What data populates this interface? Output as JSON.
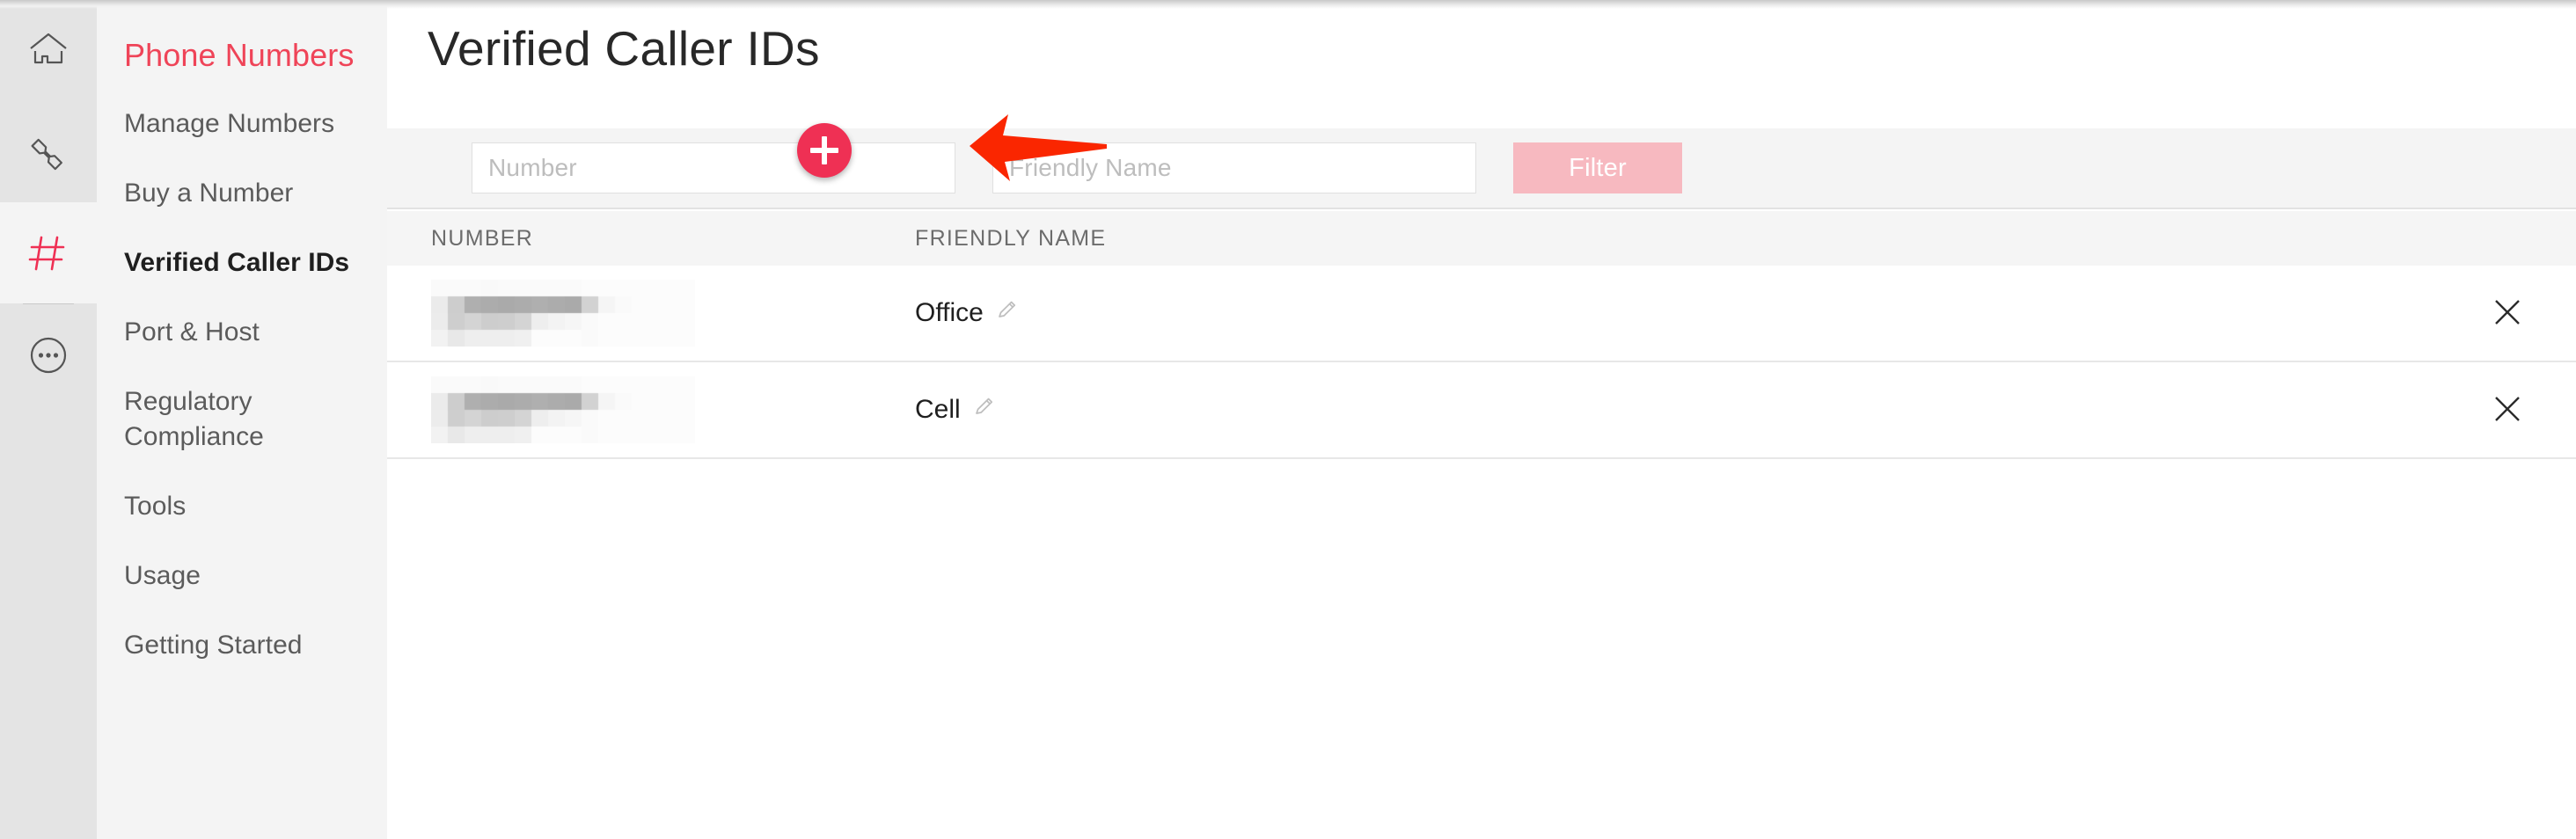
{
  "rail": {
    "items": [
      {
        "icon": "home-icon",
        "active": false
      },
      {
        "icon": "phone-icon",
        "active": false
      },
      {
        "icon": "hash-icon",
        "active": true
      },
      {
        "icon": "ellipsis-circle-icon",
        "active": false
      }
    ],
    "active_color": "#ef4458"
  },
  "sidebar": {
    "title": "Phone Numbers",
    "title_color": "#ef4458",
    "items": [
      {
        "label": "Manage Numbers",
        "selected": false
      },
      {
        "label": "Buy a Number",
        "selected": false
      },
      {
        "label": "Verified Caller IDs",
        "selected": true
      },
      {
        "label": "Port & Host",
        "selected": false
      },
      {
        "label": "Regulatory Compliance",
        "selected": false
      },
      {
        "label": "Tools",
        "selected": false
      },
      {
        "label": "Usage",
        "selected": false
      },
      {
        "label": "Getting Started",
        "selected": false
      }
    ]
  },
  "main": {
    "page_title": "Verified Caller IDs",
    "add_button": {
      "icon": "plus-icon",
      "label": ""
    },
    "filters": {
      "number": {
        "value": "",
        "placeholder": "Number"
      },
      "friendly_name": {
        "value": "",
        "placeholder": "Friendly Name"
      },
      "filter_button": {
        "label": "Filter",
        "color": "#f7b9c0",
        "disabled": true
      }
    },
    "table": {
      "columns": [
        "NUMBER",
        "FRIENDLY NAME"
      ],
      "rows": [
        {
          "number": "",
          "number_redacted": true,
          "friendly_name": "Office",
          "edit_icon": "pencil-icon",
          "delete_icon": "close-icon"
        },
        {
          "number": "",
          "number_redacted": true,
          "friendly_name": "Cell",
          "edit_icon": "pencil-icon",
          "delete_icon": "close-icon"
        }
      ]
    }
  },
  "annotation": {
    "arrow": {
      "direction": "left",
      "color": "#fa2600"
    }
  }
}
